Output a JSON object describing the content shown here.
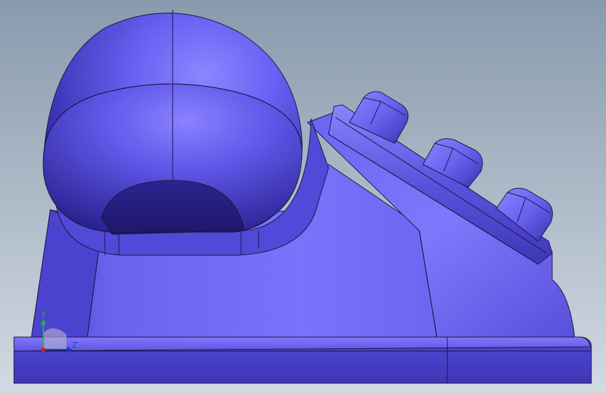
{
  "viewport": {
    "background_top": "#889aad",
    "background_bottom": "#d2dae2",
    "part_color": "#6b63f2",
    "edge_color": "#1a1640"
  },
  "triad": {
    "y_label": "Y",
    "z_label": "Z",
    "y_color": "#18c018",
    "z_color": "#1838d8",
    "x_color": "#d81818"
  }
}
